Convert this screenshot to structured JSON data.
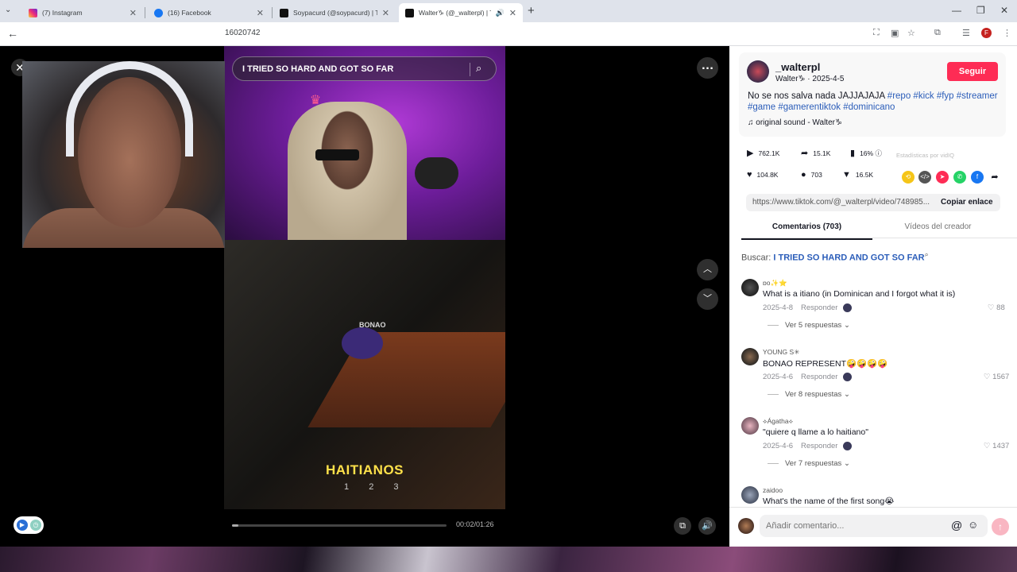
{
  "browser": {
    "tabs": [
      {
        "title": "(7) Instagram"
      },
      {
        "title": "(16) Facebook"
      },
      {
        "title": "Soypacurd (@soypacurd) | TikTok"
      },
      {
        "title": "Walter♑ (@_walterpl) | TikT"
      }
    ],
    "url": "16020742"
  },
  "video": {
    "search_query": "I TRIED SO HARD AND GOT SO FAR",
    "caption": "HAITIANOS",
    "choice_numbers": [
      "1",
      "2",
      "3"
    ],
    "in_video_sign": "BONAO",
    "time": "00:02/01:26",
    "progress": 0.03
  },
  "post": {
    "handle": "_walterpl",
    "display_name": "Walter♑",
    "date": "2025-4-5",
    "follow_label": "Seguir",
    "description_text": "No se nos salva nada JAJJAJAJA",
    "hashtags": [
      "#repo",
      "#kick",
      "#fyp",
      "#streamer",
      "#game",
      "#gamerentiktok",
      "#dominicano"
    ],
    "sound": "original sound - Walter♑",
    "plays": "762.1K",
    "shares": "15.1K",
    "percent": "16%",
    "stats_note": "Estadísticas por vidIQ",
    "likes": "104.8K",
    "comments": "703",
    "saves": "16.5K",
    "link": "https://www.tiktok.com/@_walterpl/video/748985...",
    "copy_label": "Copiar enlace"
  },
  "panel_tabs": {
    "comments": "Comentarios (703)",
    "creator_videos": "Vídeos del creador"
  },
  "search_prefix": "Buscar:",
  "search_term": "I TRIED SO HARD AND GOT SO FAR",
  "comments": [
    {
      "user": "ɒo✨⭐",
      "text": "What is a itiano (in Dominican and I forgot what it is)",
      "date": "2025-4-8",
      "reply": "Responder",
      "likes": "88",
      "more": "Ver 5 respuestas"
    },
    {
      "user": "YOUNG S✳",
      "text": "BONAO REPRESENT🤪🤪🤪🤪",
      "date": "2025-4-6",
      "reply": "Responder",
      "likes": "1567",
      "more": "Ver 8 respuestas"
    },
    {
      "user": "⟡Ágatha⟡",
      "text": "\"quiere q llame a lo haitiano\"",
      "date": "2025-4-6",
      "reply": "Responder",
      "likes": "1437",
      "more": "Ver 7 respuestas"
    },
    {
      "user": "zaidoo",
      "text": "What's the name of the first song😭",
      "date": "",
      "reply": "",
      "likes": "",
      "more": ""
    }
  ],
  "comment_input_placeholder": "Añadir comentario...",
  "colors": {
    "accent": "#fe2c55",
    "hashtag": "#2b5db9",
    "tab_bg": "#dfe3eb"
  }
}
